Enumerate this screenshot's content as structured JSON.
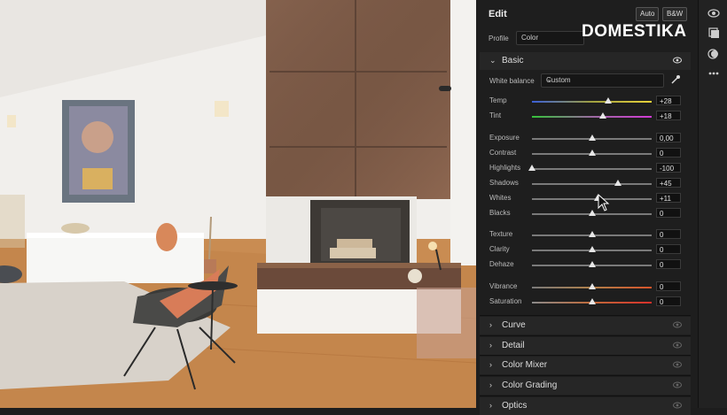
{
  "panel": {
    "title": "Edit",
    "auto_label": "Auto",
    "bw_label": "B&W",
    "profile_label": "Profile",
    "profile_value": "Color",
    "logo": "DOMESTIKA"
  },
  "basic": {
    "title": "Basic",
    "white_balance_label": "White balance",
    "white_balance_value": "Custom",
    "sliders": [
      {
        "label": "Temp",
        "value": "+28",
        "pos": 0.64
      },
      {
        "label": "Tint",
        "value": "+18",
        "pos": 0.59
      },
      {
        "label": "Exposure",
        "value": "0,00",
        "pos": 0.5
      },
      {
        "label": "Contrast",
        "value": "0",
        "pos": 0.5
      },
      {
        "label": "Highlights",
        "value": "-100",
        "pos": 0.0
      },
      {
        "label": "Shadows",
        "value": "+45",
        "pos": 0.72
      },
      {
        "label": "Whites",
        "value": "+11",
        "pos": 0.55
      },
      {
        "label": "Blacks",
        "value": "0",
        "pos": 0.5
      },
      {
        "label": "Texture",
        "value": "0",
        "pos": 0.5
      },
      {
        "label": "Clarity",
        "value": "0",
        "pos": 0.5
      },
      {
        "label": "Dehaze",
        "value": "0",
        "pos": 0.5
      },
      {
        "label": "Vibrance",
        "value": "0",
        "pos": 0.5
      },
      {
        "label": "Saturation",
        "value": "0",
        "pos": 0.5
      }
    ]
  },
  "sections": [
    "Curve",
    "Detail",
    "Color Mixer",
    "Color Grading",
    "Optics"
  ],
  "icons": {
    "chevron_down": "chevron-down-icon",
    "chevron_right": "chevron-right-icon",
    "eye": "eye-icon",
    "eyedropper": "eyedropper-icon",
    "cursor": "mouse-cursor-icon"
  }
}
